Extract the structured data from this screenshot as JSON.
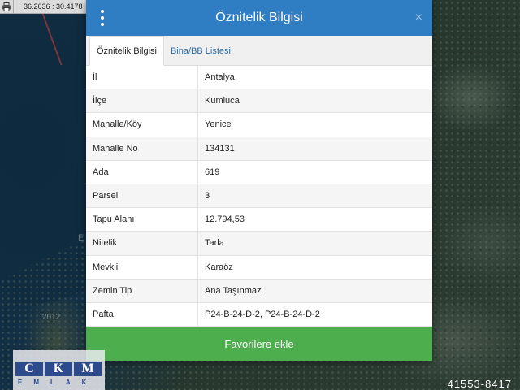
{
  "toolbar": {
    "coordinates": "36.2636 : 30.4178",
    "print_icon": "printer-icon"
  },
  "map": {
    "label_e": "E",
    "label_num": "2012",
    "bottom_number": "41553-8417"
  },
  "modal": {
    "title": "Öznitelik Bilgisi",
    "close_label": "×",
    "tabs": [
      {
        "label": "Öznitelik Bilgisi",
        "active": true
      },
      {
        "label": "Bina/BB Listesi",
        "active": false
      }
    ],
    "rows": [
      {
        "key": "İl",
        "value": "Antalya"
      },
      {
        "key": "İlçe",
        "value": "Kumluca"
      },
      {
        "key": "Mahalle/Köy",
        "value": "Yenice"
      },
      {
        "key": "Mahalle No",
        "value": "134131"
      },
      {
        "key": "Ada",
        "value": "619"
      },
      {
        "key": "Parsel",
        "value": "3"
      },
      {
        "key": "Tapu Alanı",
        "value": "12.794,53"
      },
      {
        "key": "Nitelik",
        "value": "Tarla"
      },
      {
        "key": "Mevkii",
        "value": "Karaöz"
      },
      {
        "key": "Zemin Tip",
        "value": "Ana Taşınmaz"
      },
      {
        "key": "Pafta",
        "value": "P24-B-24-D-2, P24-B-24-D-2"
      }
    ],
    "favorite_button": "Favorilere ekle"
  },
  "logo": {
    "letters": [
      "C",
      "K",
      "M"
    ],
    "subtitle": "EMLAK"
  },
  "colors": {
    "header": "#2f7ec4",
    "favorite_button": "#4cae4c",
    "tab_link": "#2f6fa8"
  }
}
